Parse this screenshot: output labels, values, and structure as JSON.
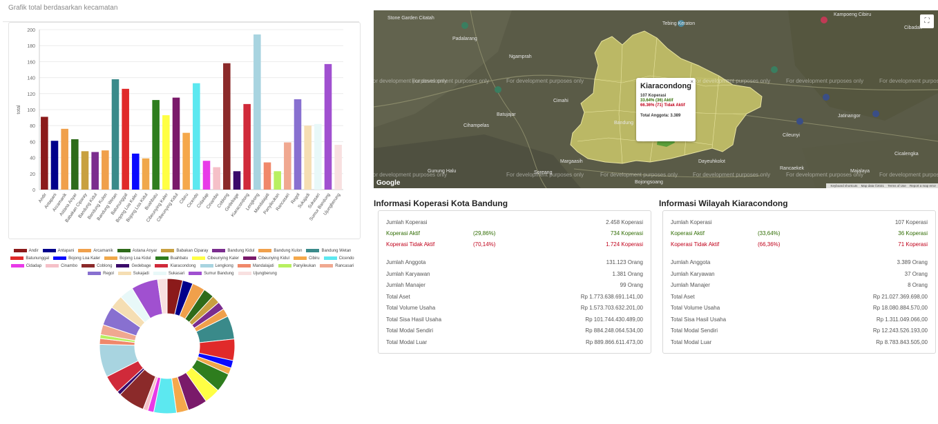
{
  "left": {
    "chart_title": "Grafik total berdasarkan kecamatan"
  },
  "chart_data": [
    {
      "type": "bar",
      "ylabel": "total",
      "ylim": [
        0,
        200
      ],
      "yticks": [
        0,
        20,
        40,
        60,
        80,
        100,
        120,
        140,
        160,
        180,
        200
      ],
      "categories": [
        "Andir",
        "Antapani",
        "Arcamanik",
        "Astana Anyar",
        "Babakan Ciparay",
        "Bandung Kidul",
        "Bandung Kulon",
        "Bandung Wetan",
        "Batununggal",
        "Bojong Loa Kaler",
        "Bojong Loa Kidul",
        "Buahbatu",
        "Cibeunying Kaler",
        "Cibeunying Kidul",
        "Cibiru",
        "Cicendo",
        "Cidadap",
        "Cinambo",
        "Coblong",
        "Gedebage",
        "Kiaracondong",
        "Lengkong",
        "Mandalajati",
        "Panyileukan",
        "Rancasari",
        "Regol",
        "Sukajadi",
        "Sukasari",
        "Sumur Bandung",
        "Ujungberung"
      ],
      "values": [
        91,
        61,
        76,
        63,
        48,
        47,
        49,
        138,
        126,
        45,
        39,
        112,
        93,
        115,
        71,
        133,
        36,
        28,
        158,
        23,
        107,
        194,
        34,
        23,
        59,
        113,
        80,
        82,
        157,
        56
      ],
      "colors": [
        "#8b1a1a",
        "#00008b",
        "#f0a04b",
        "#2e6b1a",
        "#c8a040",
        "#7b2d8e",
        "#f0a04b",
        "#3a8a8a",
        "#e02a2a",
        "#0a0aff",
        "#f0a84b",
        "#2e7d1e",
        "#ffff44",
        "#7a1a6a",
        "#f5a84b",
        "#5ce8f0",
        "#e83ae8",
        "#f5c0c8",
        "#8b2a2a",
        "#3a0a6a",
        "#d02a3a",
        "#a8d4e0",
        "#f0886a",
        "#b8f060",
        "#f0a890",
        "#8870d0",
        "#f5deb3",
        "#e8f8f8",
        "#a050d0",
        "#f8e0e0"
      ]
    },
    {
      "type": "pie",
      "categories": [
        "Andir",
        "Antapani",
        "Arcamanik",
        "Astana Anyar",
        "Babakan Ciparay",
        "Bandung Kidul",
        "Bandung Kulon",
        "Bandung Wetan",
        "Batununggal",
        "Bojong Loa Kaler",
        "Bojong Loa Kidul",
        "Buahbatu",
        "Cibeunying Kaler",
        "Cibeunying Kidul",
        "Cibiru",
        "Cicendo",
        "Cidadap",
        "Cinambo",
        "Coblong",
        "Gedebage",
        "Kiaracondong",
        "Lengkong",
        "Mandalajati",
        "Panyileukan",
        "Rancasari",
        "Regol",
        "Sukajadi",
        "Sukasari",
        "Sumur Bandung",
        "Ujungberung"
      ],
      "values": [
        91,
        61,
        76,
        63,
        48,
        47,
        49,
        138,
        126,
        45,
        39,
        112,
        93,
        115,
        71,
        133,
        36,
        28,
        158,
        23,
        107,
        194,
        34,
        23,
        59,
        113,
        80,
        82,
        157,
        56
      ]
    }
  ],
  "map": {
    "watermark": "For development purposes only",
    "fullscreen_icon": "fullscreen-icon",
    "google": "Google",
    "footer": [
      "Keyboard shortcuts",
      "Map data ©2021",
      "Terms of Use",
      "Report a map error"
    ],
    "places": [
      "Stone Garden Citatah",
      "Tebing Keraton",
      "Kampoeng Cibiru",
      "Cibadak",
      "Padalarang",
      "Ngamprah",
      "Cimahi",
      "Batujajar",
      "Cihampelas",
      "Gunung Halu",
      "Soreang",
      "Dayeuhkolot",
      "Margaasih",
      "Bandung",
      "Jatinangor",
      "Cicalengka",
      "Rancaekek",
      "Cileunyi",
      "Bojongsoang",
      "Majalaya"
    ],
    "info": {
      "title": "Kiaracondong",
      "koperasi": "107 Koperasi",
      "aktif": "33.64% (36) Aktif",
      "tidak_aktif": "66.36% (71) Tidak Aktif",
      "anggota": "Total Anggota: 3.389"
    }
  },
  "kota": {
    "title": "Informasi Koperasi Kota Bandung",
    "rows": [
      {
        "label": "Jumlah Koperasi",
        "pct": "",
        "value": "2.458 Koperasi"
      },
      {
        "label": "Koperasi Aktif",
        "pct": "(29,86%)",
        "value": "734 Koperasi"
      },
      {
        "label": "Koperasi Tidak Aktif",
        "pct": "(70,14%)",
        "value": "1.724 Koperasi"
      },
      {
        "label": "Jumlah Anggota",
        "pct": "",
        "value": "131.123 Orang"
      },
      {
        "label": "Jumlah Karyawan",
        "pct": "",
        "value": "1.381 Orang"
      },
      {
        "label": "Jumlah Manajer",
        "pct": "",
        "value": "99 Orang"
      },
      {
        "label": "Total Aset",
        "pct": "",
        "value": "Rp 1.773.638.691.141,00"
      },
      {
        "label": "Total Volume Usaha",
        "pct": "",
        "value": "Rp 1.573.703.632.201,00"
      },
      {
        "label": "Total Sisa Hasil Usaha",
        "pct": "",
        "value": "Rp 101.744.430.489,00"
      },
      {
        "label": "Total Modal Sendiri",
        "pct": "",
        "value": "Rp 884.248.064.534,00"
      },
      {
        "label": "Total Modal Luar",
        "pct": "",
        "value": "Rp 889.866.611.473,00"
      }
    ]
  },
  "wilayah": {
    "title": "Informasi Wilayah Kiaracondong",
    "rows": [
      {
        "label": "Jumlah Koperasi",
        "pct": "",
        "value": "107 Koperasi"
      },
      {
        "label": "Koperasi Aktif",
        "pct": "(33,64%)",
        "value": "36 Koperasi"
      },
      {
        "label": "Koperasi Tidak Aktif",
        "pct": "(66,36%)",
        "value": "71 Koperasi"
      },
      {
        "label": "Jumlah Anggota",
        "pct": "",
        "value": "3.389 Orang"
      },
      {
        "label": "Jumlah Karyawan",
        "pct": "",
        "value": "37 Orang"
      },
      {
        "label": "Jumlah Manajer",
        "pct": "",
        "value": "8 Orang"
      },
      {
        "label": "Total Aset",
        "pct": "",
        "value": "Rp 21.027.369.698,00"
      },
      {
        "label": "Total Volume Usaha",
        "pct": "",
        "value": "Rp 18.080.884.570,00"
      },
      {
        "label": "Total Sisa Hasil Usaha",
        "pct": "",
        "value": "Rp 1.311.049.066,00"
      },
      {
        "label": "Total Modal Sendiri",
        "pct": "",
        "value": "Rp 12.243.526.193,00"
      },
      {
        "label": "Total Modal Luar",
        "pct": "",
        "value": "Rp 8.783.843.505,00"
      }
    ]
  }
}
